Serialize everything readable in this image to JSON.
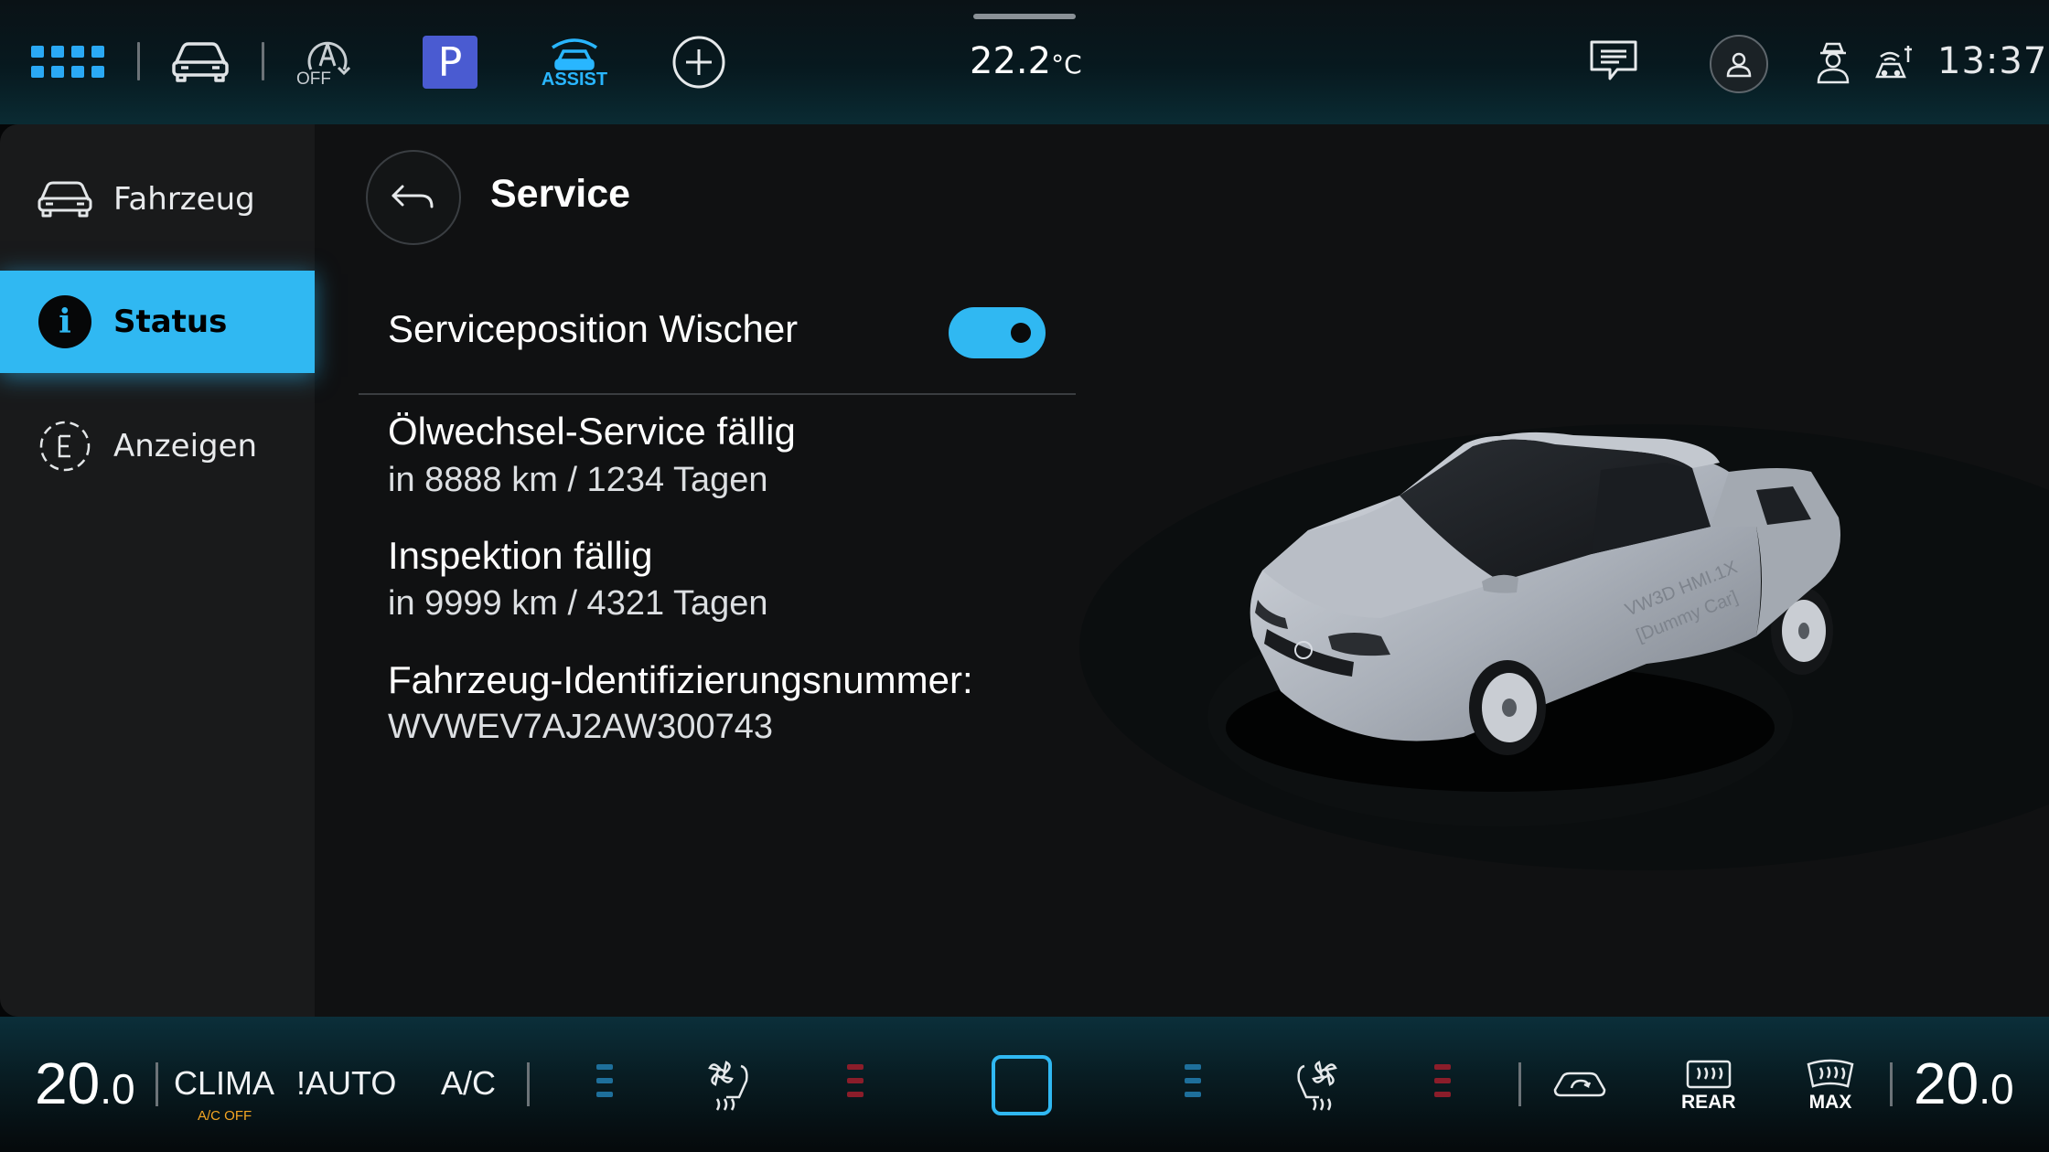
{
  "topbar": {
    "assist_label": "ASSIST",
    "auto_hold_label": "OFF",
    "parking_label": "P",
    "temperature_value": "22.2",
    "temperature_unit": "°C",
    "time": "13:37"
  },
  "sidebar": {
    "items": [
      {
        "label": "Fahrzeug",
        "icon": "car-icon",
        "active": false
      },
      {
        "label": "Status",
        "icon": "info-icon",
        "active": true
      },
      {
        "label": "Anzeigen",
        "icon": "display-e-icon",
        "active": false
      }
    ]
  },
  "main": {
    "title": "Service",
    "toggle": {
      "label": "Serviceposition Wischer",
      "state": "on"
    },
    "entries": [
      {
        "label": "Ölwechsel-Service fällig",
        "value": "in 8888 km / 1234 Tagen"
      },
      {
        "label": "Inspektion fällig",
        "value": "in 9999 km / 4321 Tagen"
      },
      {
        "label": "Fahrzeug-Identifizierungsnummer:",
        "value": "WVWEV7AJ2AW300743"
      }
    ],
    "car_decal_line1": "VW3D HMI.1X",
    "car_decal_line2": "[Dummy Car]"
  },
  "climate": {
    "left_temp_int": "20",
    "left_temp_dec": ".0",
    "right_temp_int": "20",
    "right_temp_dec": ".0",
    "clima_label": "CLIMA",
    "ac_off_label": "A/C OFF",
    "auto_label": "!AUTO",
    "ac_label": "A/C",
    "rear_label": "REAR",
    "max_label": "MAX"
  },
  "colors": {
    "accent": "#30b8f2",
    "heat": "#8b1d2a",
    "cool": "#1e6f9b",
    "warning": "#f5a623",
    "parking": "#4a5bd1"
  }
}
